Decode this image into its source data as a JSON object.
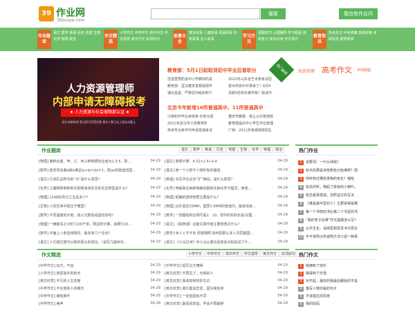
{
  "site": {
    "logo_mark": "39",
    "name": "作业网",
    "url": "39zuoye.com",
    "search_button": "搜索",
    "mine_button": "我也有作业问",
    "accent": "#6fc06b",
    "orange": "#e06a26"
  },
  "nav": [
    {
      "label": "作业题库",
      "links": "语文 数学 英语 历史 地理 生物 化学 物理 政治"
    },
    {
      "label": "作文精选",
      "links": "小学作文 中学作文 高中作文 作文指导 英文作文 好词好句"
    },
    {
      "label": "故事大全",
      "links": "寓言故事 儿童故事 成语故事 传奇故事 名人故事"
    },
    {
      "label": "学习方法",
      "links": "语题技巧 心理辅导 学习经验 高考复习 家长必读 作文技巧"
    },
    {
      "label": "教育资讯",
      "links": "热点关注 中考政策 高考政策 考研信息 教育新闻"
    }
  ],
  "banner": {
    "line1": "人力资源管理师",
    "line2": "内部申请无障碍报考",
    "line3": "★ 人力资源与社会保障部认证 ★",
    "line4": "部分名额有限 登记即可享受优惠 报名人数已达上限自动截止"
  },
  "headline1": {
    "title": "教育部：5月1日起取消初中毕业后普职分",
    "left": [
      "性侵害预防进中小学教材的具",
      "教育部：坚决奠定变相违规开",
      "湖北宜昌：严禁任何组织和个"
    ],
    "right": [
      "2022年山东省艺术类考试招",
      "苍州市高中补录来了！6月4",
      "清朝3名校长被开除！取消今"
    ]
  },
  "headline2": {
    "title": "北京今年新增16所普通高中，11所普通高中",
    "left": [
      "江西初中毕业考结束 红色元素",
      "2021年武汉市义务教育阶",
      "高考符合条件可申请单独考试"
    ],
    "right": [
      "重庆市教委：禁止公办普通高",
      "教育部提出中小学生作业管理",
      "广西：2021年普通高校招生"
    ]
  },
  "promo": {
    "ribbon": "热门推荐",
    "p1": "光合作用",
    "p2": "高考作文",
    "p3": "平均经验"
  },
  "homework": {
    "title": "作业题库",
    "tabs": [
      "语文",
      "数学",
      "英语",
      "历史",
      "地理",
      "生物",
      "化学",
      "物理",
      "政治"
    ],
    "left": [
      {
        "t": "[物理] 某种合金，甲、乙、丙三种物质的比值为2:3:5，则...",
        "d": "04-29"
      },
      {
        "t": "[数学] 若非零向量a和b满足|a+b|=|b|=2，则|a|的取值范围...",
        "d": "04-29"
      },
      {
        "t": "[语文] 行测孔具所为的“为”是什么意思？",
        "d": "04-29"
      },
      {
        "t": "[化学] 乙醛和新制氧氧化铜悬浊液反应的反应类型是什么?",
        "d": "04-29"
      },
      {
        "t": "[物理] 1248的百分之五是多少?",
        "d": "04-29"
      },
      {
        "t": "[生物] 人的生命中枢位于哪里？",
        "d": "04-29"
      },
      {
        "t": "[数学] 不同温度的大地，其火光颜色是固定的吗？",
        "d": "04-29"
      },
      {
        "t": "[物理] 一辆客车2小时行100千米，照这样计算，如果行20...",
        "d": "04-29"
      },
      {
        "t": "[数学] 平面上八条直线相交，最多有几个交点？",
        "d": "04-29"
      },
      {
        "t": "[语文] 人们通过宽可以取的更大的成功，（请写几篇辩论...",
        "d": "04-29"
      }
    ],
    "right": [
      {
        "t": "[语文] 简便计算：4.32×1.6÷0.4",
        "d": "04-29"
      },
      {
        "t": "[语文] 用一个小狗于人物形象的描述。",
        "d": "04-29"
      },
      {
        "t": "[英语] 书写字化合法“扩“挣动，是什么意思？",
        "d": "04-29"
      },
      {
        "t": "[化学] 电解氯化钠和电解熔融氧化钠化学方程式，用途...",
        "d": "04-29"
      },
      {
        "t": "[物理] 铝棚的遗传物质主要是什么？",
        "d": "04-29"
      },
      {
        "t": "[物理] 合外直径20MM，壁厚1.5MM的管道内，能有效承...",
        "d": "04-29"
      },
      {
        "t": "[数学] 一张图纸的比例尺是1：10，零件的实际长是32厘...",
        "d": "04-29"
      },
      {
        "t": "[语文] 《搞笑城》这篇文章作者主要想表达什么？",
        "d": "04-29"
      },
      {
        "t": "[数学] 世人人不不负 肝胆相照 如何把那么多人共同建国...",
        "d": "04-29"
      },
      {
        "t": "[语文] 《小马过河》中小马从勇功回家后对妈妈说了什...",
        "d": "04-29"
      }
    ]
  },
  "essay": {
    "title": "作文精选",
    "tabs": [
      "小学作文",
      "中学作文",
      "高中作文",
      "作文指导",
      "英文作文",
      "好词好句"
    ],
    "left": [
      {
        "t": "[中学作文] 远方，不远",
        "d": "04-29"
      },
      {
        "t": "[小学作文] 我爱故乡的秋天",
        "d": "04-29"
      },
      {
        "t": "[英文欣赏] 平凡的人生态度",
        "d": "04-29"
      },
      {
        "t": "[中学作文] 不在意别人的眼光",
        "d": "04-28"
      },
      {
        "t": "[中学作文] 撕枝撕叶",
        "d": "04-28"
      },
      {
        "t": "[中学作文] 美声",
        "d": "04-28"
      }
    ],
    "right": [
      {
        "t": "[中学作文] 经历过才懂得",
        "d": "04-29"
      },
      {
        "t": "[英文欣赏] 不再见了，无缘的人",
        "d": "04-29"
      },
      {
        "t": "[英文欣赏] 我该如何将你忘记",
        "d": "04-29"
      },
      {
        "t": "[英文欣赏] 我们能谈恋爱，因为我信命",
        "d": "04-29"
      },
      {
        "t": "[中学作文] 一切皆因有不同",
        "d": "04-29"
      },
      {
        "t": "[英文欣赏] 最喜欢的是，学会不再破碎",
        "d": "04-29"
      }
    ]
  },
  "hot_homework": {
    "title": "热门作业",
    "items": [
      "说要词：一什么绿毯？",
      "秋天的那是诗批数色分给谁呢？想",
      "你听到过哪些事物的变化？唱哈",
      "有关的听，我起了染色的小喇叭。",
      "有志者事竟成，仿照谈文的写法",
      "《谁是最可爱的人》主要讲得是哪",
      "第一个书较的书比第二个书显的书",
      "“我的李子好难”作文提纲怎么写？",
      "以平生化，请用思想思念书与思论",
      "平平普例子的说明方法介绍一种事"
    ]
  },
  "hot_essay": {
    "title": "热门作文",
    "items": [
      "我拥有了快乐",
      "我得到了珍惜",
      "对不起，最好的我最后都给的不是",
      "描写人物外貌的句子",
      "不该错过的风景",
      "我的妈妈"
    ]
  }
}
